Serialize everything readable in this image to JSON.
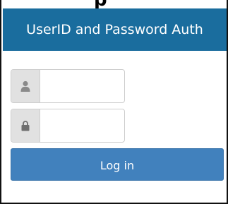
{
  "header": {
    "title": "UserID and Password Auth"
  },
  "top_fragment": "p",
  "form": {
    "userid": {
      "value": "",
      "icon": "user-icon"
    },
    "password": {
      "value": "",
      "icon": "lock-icon"
    },
    "login_label": "Log in"
  },
  "colors": {
    "header_bg": "#1a6d9e",
    "button_bg": "#4181bd",
    "addon_bg": "#e1e1e1"
  }
}
